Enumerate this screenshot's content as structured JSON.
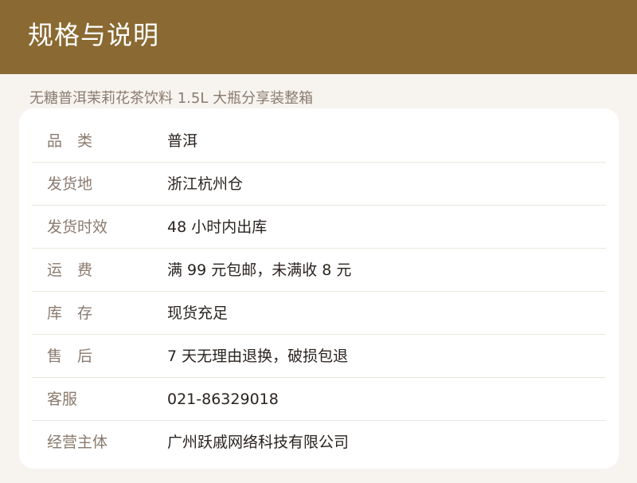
{
  "header": {
    "title": "规格与说明"
  },
  "product": {
    "name": "无糖普洱茉莉花茶饮料 1.5L 大瓶分享装整箱"
  },
  "specs": [
    {
      "label": "品　类",
      "value": "普洱"
    },
    {
      "label": "发货地",
      "value": "浙江杭州仓"
    },
    {
      "label": "发货时效",
      "value": "48 小时内出库"
    },
    {
      "label": "运　费",
      "value": "满 99 元包邮，未满收 8 元"
    },
    {
      "label": "库　存",
      "value": "现货充足"
    },
    {
      "label": "售　后",
      "value": "7 天无理由退换，破损包退"
    },
    {
      "label": "客服",
      "value": "021-86329018"
    },
    {
      "label": "经营主体",
      "value": "广州跃戚网络科技有限公司"
    }
  ],
  "colors": {
    "header_bg": "#8a6a32",
    "page_bg": "#f7f4f0",
    "label": "#8a7a6e",
    "value": "#2a2420"
  }
}
